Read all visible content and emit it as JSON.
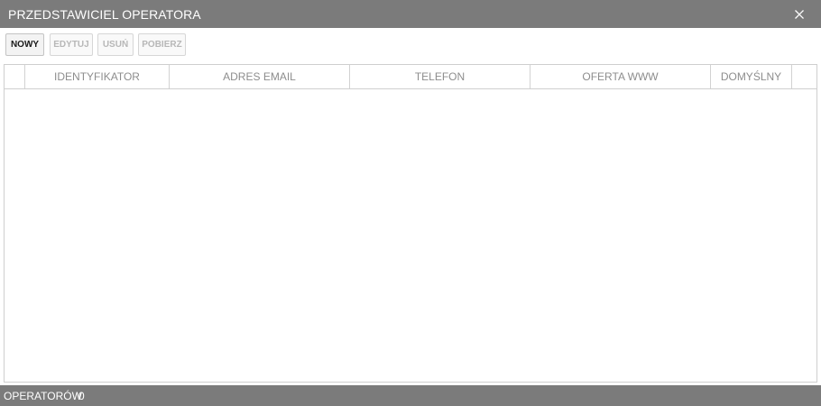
{
  "window": {
    "title": "PRZEDSTAWICIEL OPERATORA",
    "close_icon": "close-icon"
  },
  "toolbar": {
    "new_label": "NOWY",
    "edit_label": "EDYTUJ",
    "delete_label": "USUŃ",
    "fetch_label": "POBIERZ"
  },
  "table": {
    "columns": [
      "IDENTYFIKATOR",
      "ADRES EMAIL",
      "TELEFON",
      "OFERTA WWW",
      "DOMYŚLNY"
    ],
    "rows": []
  },
  "status": {
    "label": "OPERATORÓW",
    "count": "0"
  },
  "colors": {
    "chrome": "#7b7b7b",
    "border": "#cfcfcf",
    "header_text": "#8d8d8d"
  }
}
